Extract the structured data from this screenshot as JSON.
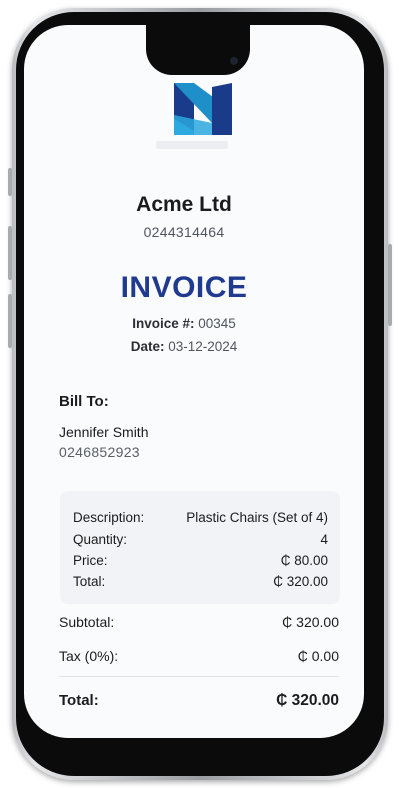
{
  "company": {
    "name": "Acme Ltd",
    "phone": "0244314464",
    "logo_icon": "acme-logo-icon",
    "logo_colors": [
      "#1a3a8a",
      "#1e8fc8",
      "#3ab5e6"
    ]
  },
  "invoice": {
    "title": "INVOICE",
    "number_label": "Invoice #:",
    "number": "00345",
    "date_label": "Date:",
    "date": "03-12-2024",
    "title_color": "#1f3a8f"
  },
  "bill_to": {
    "label": "Bill To:",
    "name": "Jennifer Smith",
    "phone": "0246852923"
  },
  "item": {
    "description_label": "Description:",
    "description": "Plastic Chairs (Set of 4)",
    "quantity_label": "Quantity:",
    "quantity": "4",
    "price_label": "Price:",
    "price": "₵ 80.00",
    "total_label": "Total:",
    "total": "₵ 320.00"
  },
  "summary": {
    "subtotal_label": "Subtotal:",
    "subtotal": "₵ 320.00",
    "tax_label": "Tax (0%):",
    "tax": "₵ 0.00",
    "total_label": "Total:",
    "total": "₵ 320.00"
  }
}
